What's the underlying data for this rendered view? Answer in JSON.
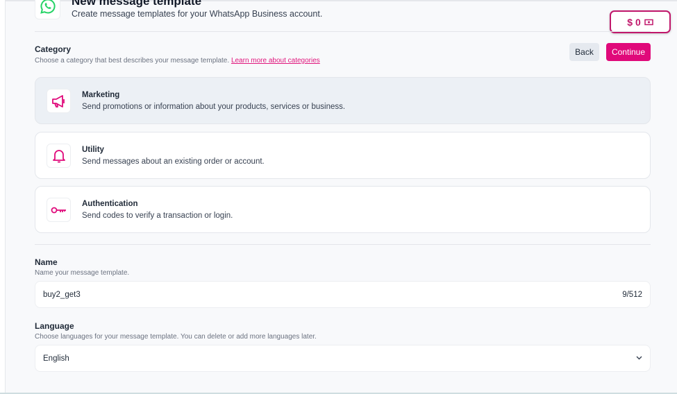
{
  "header": {
    "title": "New message template",
    "subtitle": "Create message templates for your WhatsApp Business account."
  },
  "balance": {
    "amount": "$ 0"
  },
  "category": {
    "heading": "Category",
    "description": "Choose a category that best describes your message template.",
    "link": "Learn more about categories",
    "items": [
      {
        "title": "Marketing",
        "description": "Send promotions or information about your products, services or business.",
        "selected": true
      },
      {
        "title": "Utility",
        "description": "Send messages about an existing order or account."
      },
      {
        "title": "Authentication",
        "description": "Send codes to verify a transaction or login."
      }
    ]
  },
  "actions": {
    "back": "Back",
    "continue": "Continue"
  },
  "name": {
    "heading": "Name",
    "description": "Name your message template.",
    "value": "buy2_get3",
    "counter": "9/512"
  },
  "language": {
    "heading": "Language",
    "description": "Choose languages for your message template. You can delete or add more languages later.",
    "value": "English"
  },
  "colors": {
    "accent": "#e0097a"
  }
}
